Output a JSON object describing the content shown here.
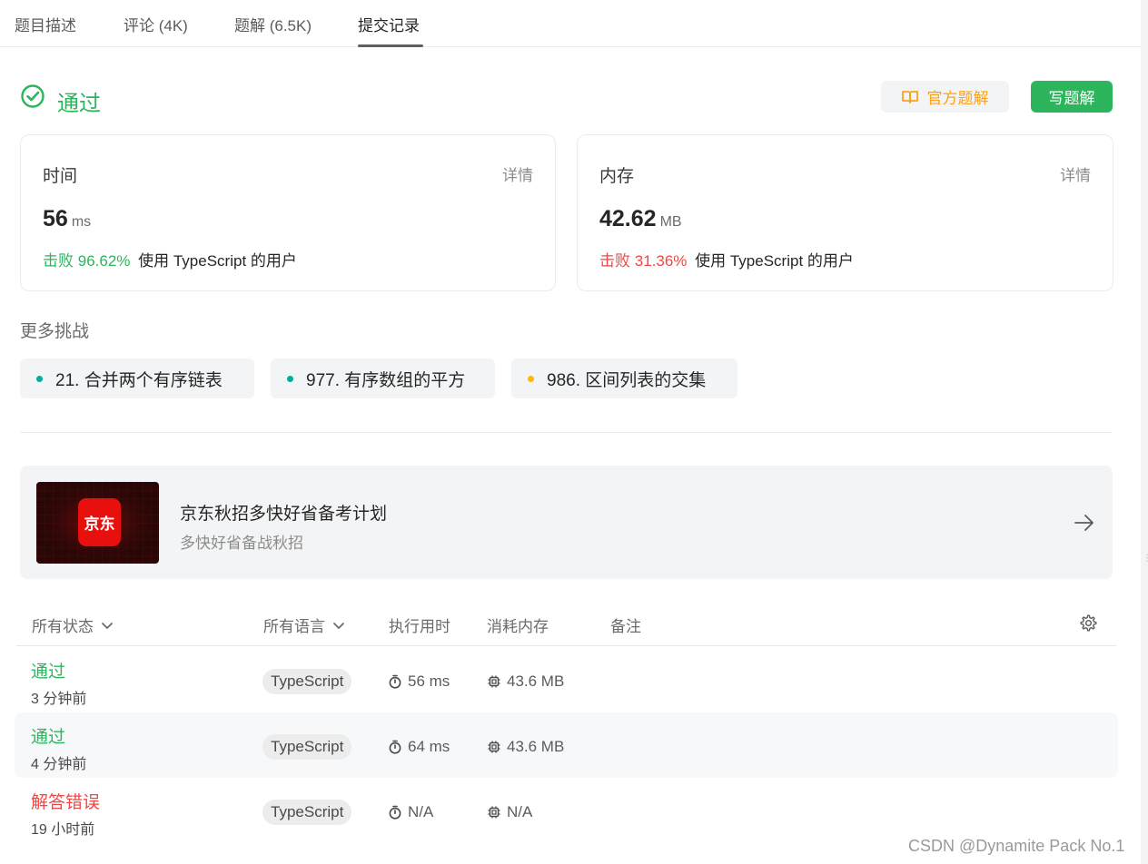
{
  "tabs": [
    {
      "label": "题目描述"
    },
    {
      "label": "评论 (4K)"
    },
    {
      "label": "题解 (6.5K)"
    },
    {
      "label": "提交记录"
    }
  ],
  "status": {
    "label": "通过",
    "color": "#2db55d"
  },
  "buttons": {
    "official_solution": "官方题解",
    "write_solution": "写题解"
  },
  "runtime_card": {
    "title": "时间",
    "detail": "详情",
    "value": "56",
    "unit": "ms",
    "beat_label": "击败",
    "beat_value": "96.62%",
    "beat_suffix": "使用 TypeScript 的用户"
  },
  "memory_card": {
    "title": "内存",
    "detail": "详情",
    "value": "42.62",
    "unit": "MB",
    "beat_label": "击败",
    "beat_value": "31.36%",
    "beat_suffix": "使用 TypeScript 的用户"
  },
  "more_challenges": {
    "title": "更多挑战",
    "items": [
      {
        "label": "21. 合并两个有序链表",
        "dot_color": "#00af9b"
      },
      {
        "label": "977. 有序数组的平方",
        "dot_color": "#00af9b"
      },
      {
        "label": "986. 区间列表的交集",
        "dot_color": "#ffb800"
      }
    ]
  },
  "banner": {
    "logo_text": "京东",
    "title": "京东秋招多快好省备考计划",
    "subtitle": "多快好省备战秋招"
  },
  "table": {
    "headers": {
      "status": "所有状态",
      "language": "所有语言",
      "runtime": "执行用时",
      "memory": "消耗内存",
      "notes": "备注"
    },
    "rows": [
      {
        "status": "通过",
        "time": "3 分钟前",
        "lang": "TypeScript",
        "runtime": "56 ms",
        "memory": "43.6 MB"
      },
      {
        "status": "通过",
        "time": "4 分钟前",
        "lang": "TypeScript",
        "runtime": "64 ms",
        "memory": "43.6 MB"
      },
      {
        "status": "解答错误",
        "time": "19 小时前",
        "lang": "TypeScript",
        "runtime": "N/A",
        "memory": "N/A"
      }
    ]
  },
  "watermark": "CSDN @Dynamite Pack No.1",
  "icons": {
    "status": "check-circle-icon",
    "official_solution": "book-icon",
    "banner_arrow": "arrow-right-icon",
    "dropdown": "chevron-down-icon",
    "settings": "gear-icon",
    "runtime": "stopwatch-icon",
    "memory": "chip-icon"
  }
}
